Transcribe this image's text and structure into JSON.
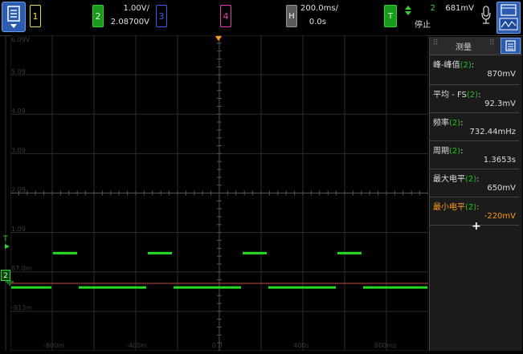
{
  "colors": {
    "ch1": "#e8e23a",
    "ch2": "#22dd22",
    "ch3": "#3b5de7",
    "ch4": "#e23ab0",
    "ch2_text": "#1cc41c",
    "highlight": "#ff9a1a",
    "accent": "#2c5cb0"
  },
  "header": {
    "ch1": "1",
    "ch2": "2",
    "ch2_scale": "1.00V/",
    "ch2_offset": "2.08700V",
    "ch3": "3",
    "ch4": "4",
    "h_label": "H",
    "timebase": "200.0ms/",
    "delay": "0.0s",
    "t_label": "T",
    "trigger_icon": "trigger-edge-icon",
    "trigger_source": "2",
    "trigger_level": "681mV",
    "status": "停止"
  },
  "plot": {
    "y_labels": [
      "6.09V",
      "5.09",
      "4.09",
      "3.09",
      "2.09",
      "1.09",
      "87.0m",
      "-913m"
    ],
    "x_labels": [
      "-800m",
      "-400m",
      "0.0",
      "400s",
      "800ms"
    ],
    "marker_T": "T",
    "marker_ch2": "2",
    "waveform": {
      "high_mV": 650,
      "low_mV": -220,
      "period_s": 1.3653
    }
  },
  "panel": {
    "title": "测量",
    "add_label": "+",
    "measurements": [
      {
        "label": "峰-峰值",
        "ch": "(2)",
        "value": "870mV",
        "highlighted": false
      },
      {
        "label": "平均 - FS",
        "ch": "(2)",
        "value": "92.3mV",
        "highlighted": false
      },
      {
        "label": "频率",
        "ch": "(2)",
        "value": "732.44mHz",
        "highlighted": false
      },
      {
        "label": "周期",
        "ch": "(2)",
        "value": "1.3653s",
        "highlighted": false
      },
      {
        "label": "最大电平",
        "ch": "(2)",
        "value": "650mV",
        "highlighted": false
      },
      {
        "label": "最小电平",
        "ch": "(2)",
        "value": "-220mV",
        "highlighted": true
      }
    ]
  }
}
